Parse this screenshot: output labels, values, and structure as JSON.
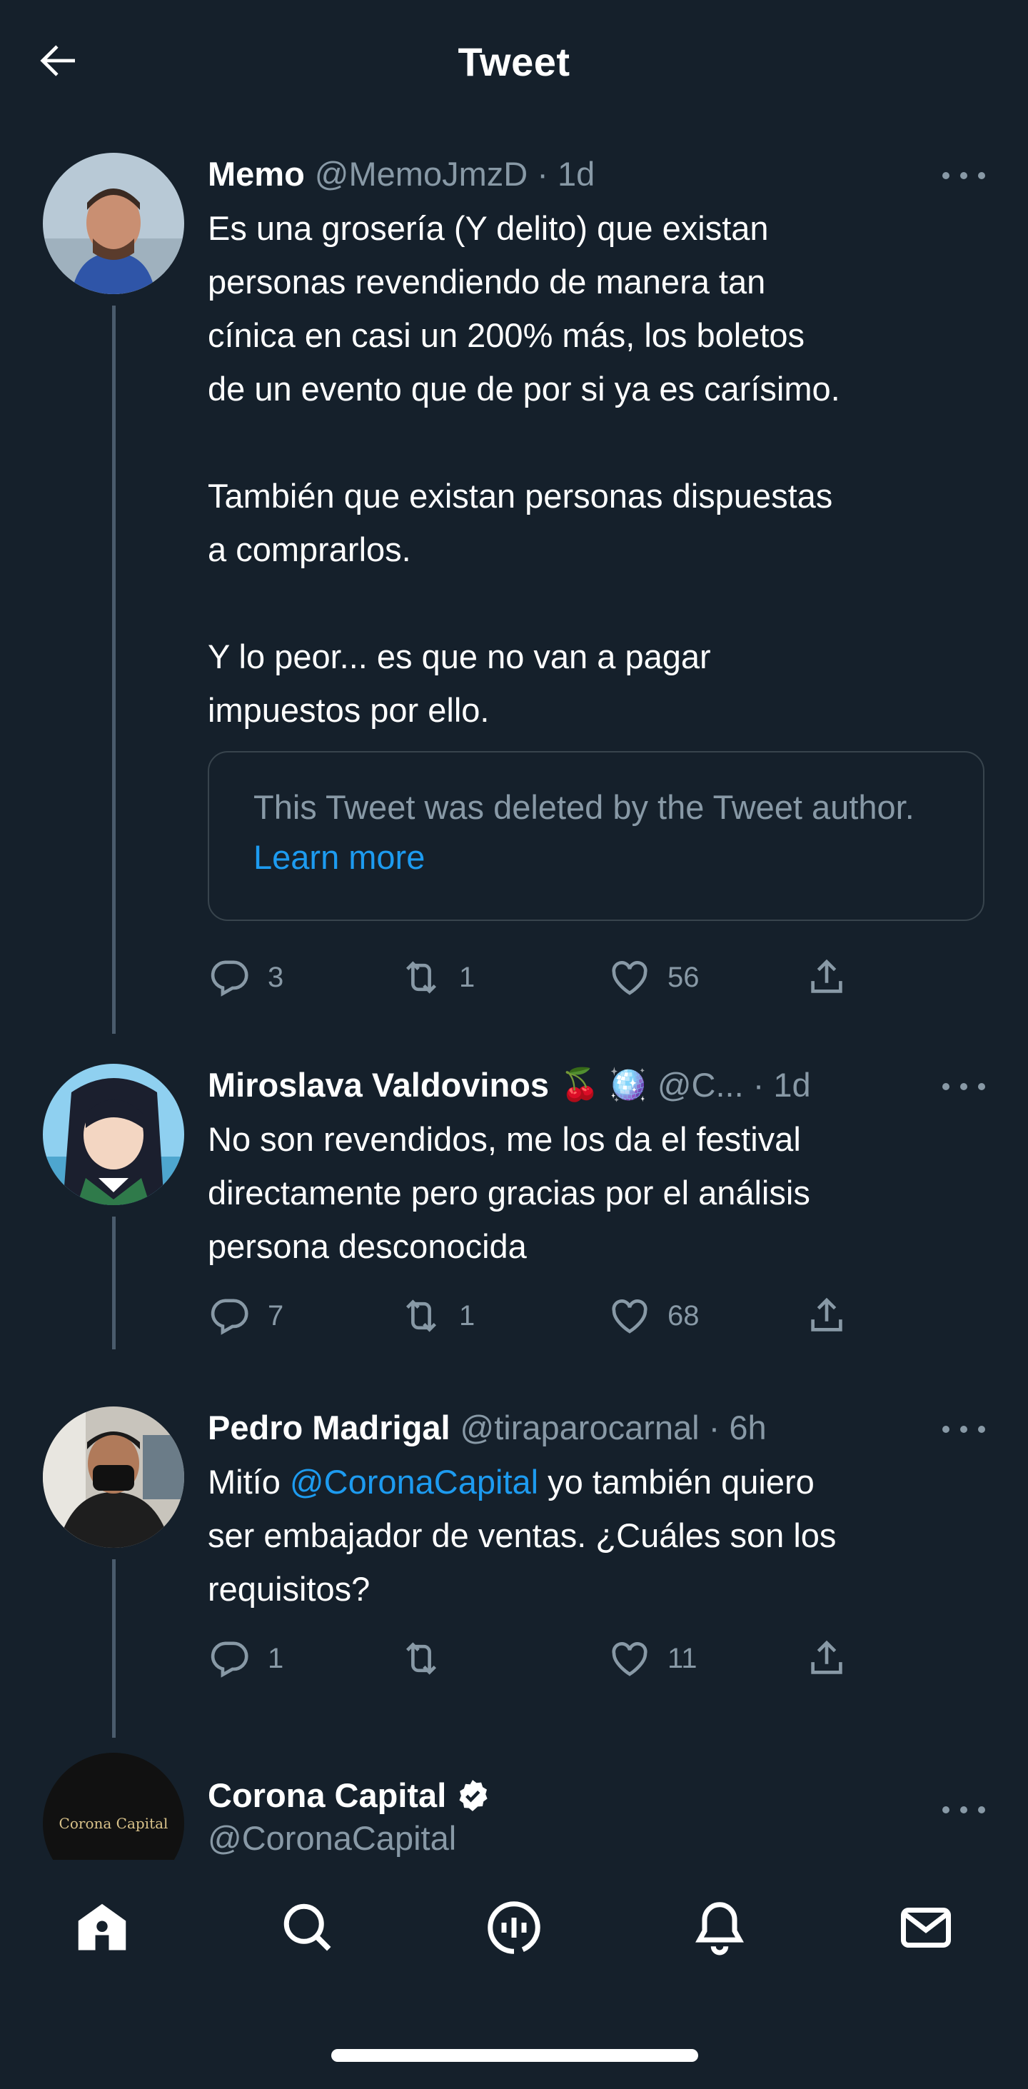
{
  "header": {
    "title": "Tweet"
  },
  "tweets": [
    {
      "name": "Memo",
      "handle": "@MemoJmzD · 1d",
      "text": "Es una grosería (Y delito) que existan\npersonas revendiendo de manera tan\ncínica en casi un 200% más, los boletos\nde un evento que de por si ya es carísimo.\n\nTambién que existan personas dispuestas\na comprarlos.\n\nY lo peor... es que no van a pagar\nimpuestos por ello.",
      "quoted": {
        "text": "This Tweet was deleted by the Tweet author.",
        "link": "Learn more"
      },
      "replies": "3",
      "retweets": "1",
      "likes": "56"
    },
    {
      "name": "Miroslava Valdovinos",
      "emoji": "🍒 🪩",
      "handle": "@C... · 1d",
      "text": "No son revendidos, me los da el festival\ndirectamente pero gracias por el análisis\npersona desconocida",
      "replies": "7",
      "retweets": "1",
      "likes": "68"
    },
    {
      "name": "Pedro Madrigal",
      "handle": "@tiraparocarnal · 6h",
      "text_before": "Mitío ",
      "mention": "@CoronaCapital",
      "text_after": " yo también quiero\nser embajador de ventas. ¿Cuáles son los\nrequisitos?",
      "replies": "1",
      "retweets": "",
      "likes": "11"
    },
    {
      "name": "Corona Capital",
      "handle": "@CoronaCapital",
      "avatar_text": "Corona Capital"
    }
  ],
  "colors": {
    "background": "#15202b",
    "secondary": "#8899a6",
    "accent": "#1d9bf0",
    "border": "#38444d"
  },
  "icons": {
    "header": "arrow-left-icon",
    "actions": [
      "reply-icon",
      "retweet-icon",
      "like-icon",
      "share-icon"
    ],
    "tabs": [
      "home-icon",
      "search-icon",
      "spaces-icon",
      "notifications-icon",
      "messages-icon"
    ]
  }
}
